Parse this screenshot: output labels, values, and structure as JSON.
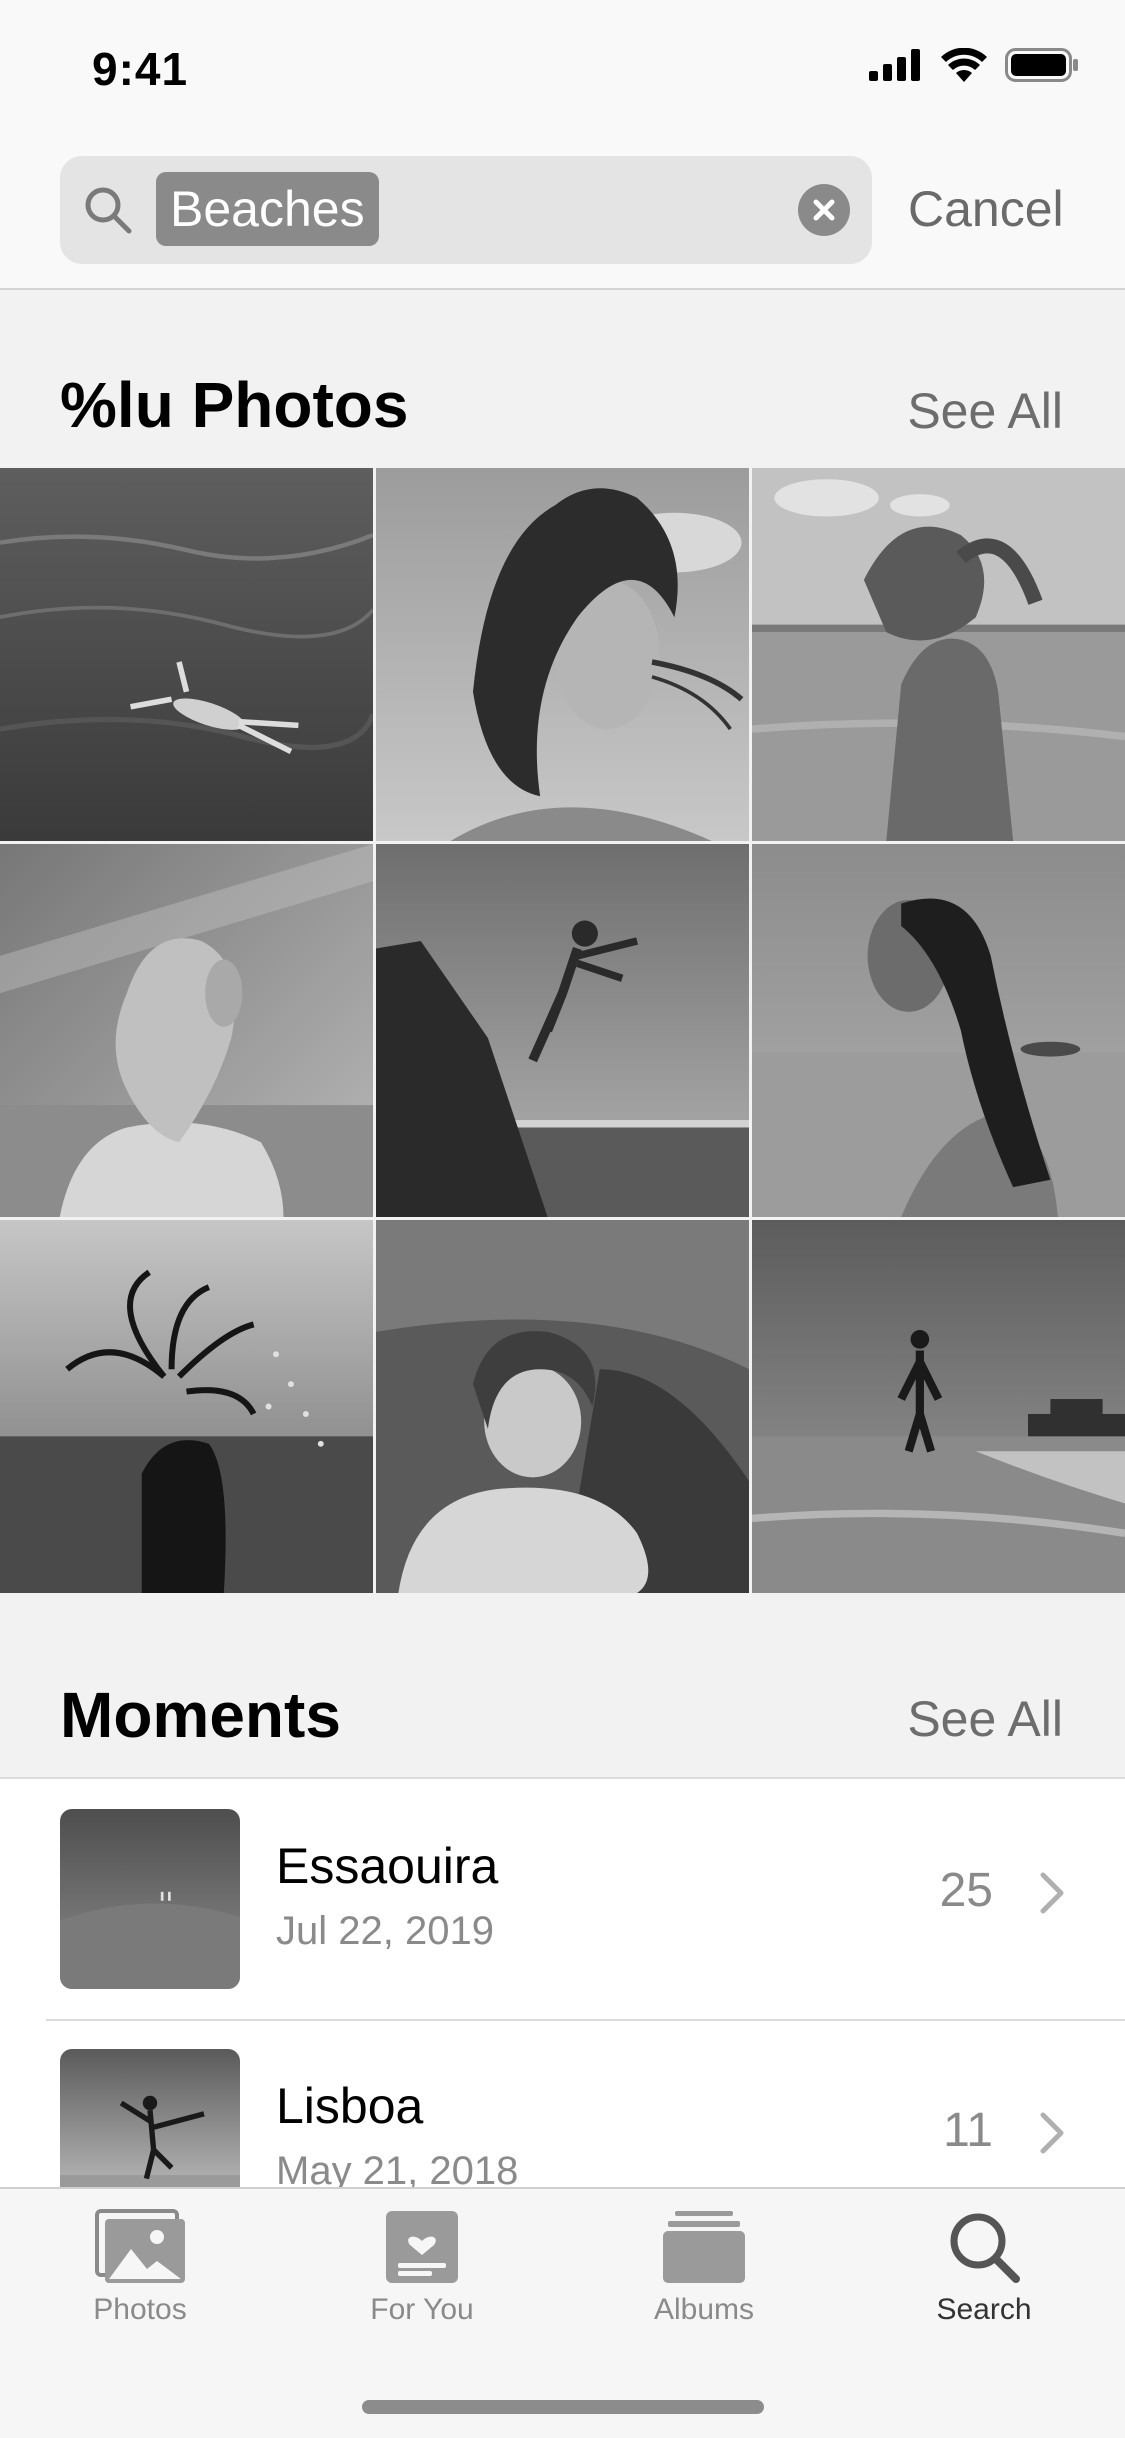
{
  "status_bar": {
    "time": "9:41",
    "icons": [
      "signal-icon",
      "wifi-icon",
      "battery-icon"
    ]
  },
  "search": {
    "query": "Beaches",
    "cancel_label": "Cancel"
  },
  "photos_section": {
    "title": "%lu Photos",
    "see_all_label": "See All"
  },
  "moments_section": {
    "title": "Moments",
    "see_all_label": "See All",
    "items": [
      {
        "title": "Essaouira",
        "date": "Jul 22, 2019",
        "count": "25"
      },
      {
        "title": "Lisboa",
        "date": "May 21, 2018",
        "count": "11"
      }
    ]
  },
  "tab_bar": {
    "tabs": [
      {
        "label": "Photos",
        "icon": "photos-icon",
        "active": false
      },
      {
        "label": "For You",
        "icon": "for-you-icon",
        "active": false
      },
      {
        "label": "Albums",
        "icon": "albums-icon",
        "active": false
      },
      {
        "label": "Search",
        "icon": "search-icon",
        "active": true
      }
    ]
  },
  "colors": {
    "background": "#f2f2f2",
    "secondary_text": "#8a8a8a",
    "accent_gray": "#6d6d6d"
  }
}
